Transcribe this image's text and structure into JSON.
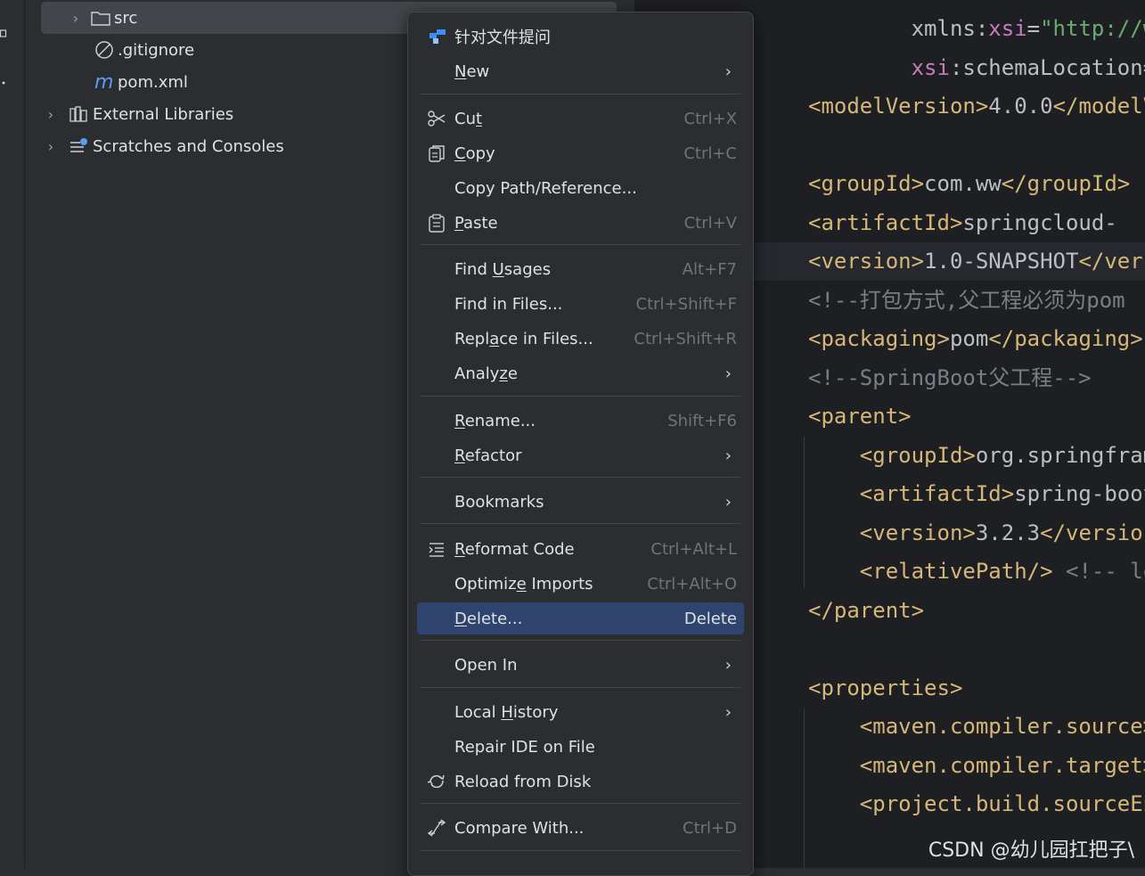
{
  "tree": {
    "items": [
      {
        "name": "src",
        "icon": "folder-icon",
        "expandable": true
      },
      {
        "name": ".gitignore",
        "icon": "ignore-file-icon",
        "expandable": false
      },
      {
        "name": "pom.xml",
        "icon": "maven-icon",
        "expandable": false
      },
      {
        "name": "External Libraries",
        "icon": "library-icon",
        "expandable": true
      },
      {
        "name": "Scratches and Consoles",
        "icon": "scratches-icon",
        "expandable": true
      }
    ]
  },
  "menu": {
    "items": [
      {
        "label": "针对文件提问",
        "shortcut": "",
        "submenu": false,
        "icon": "ai-ask-icon"
      },
      {
        "label": "New",
        "shortcut": "",
        "submenu": true,
        "icon": "",
        "u": 0
      },
      {
        "label": "Cut",
        "shortcut": "Ctrl+X",
        "submenu": false,
        "icon": "scissors-icon",
        "u": 2
      },
      {
        "label": "Copy",
        "shortcut": "Ctrl+C",
        "submenu": false,
        "icon": "copy-icon",
        "u": 0
      },
      {
        "label": "Copy Path/Reference...",
        "shortcut": "",
        "submenu": false,
        "icon": ""
      },
      {
        "label": "Paste",
        "shortcut": "Ctrl+V",
        "submenu": false,
        "icon": "clipboard-icon",
        "u": 0
      },
      {
        "label": "Find Usages",
        "shortcut": "Alt+F7",
        "submenu": false,
        "icon": "",
        "u": 5
      },
      {
        "label": "Find in Files...",
        "shortcut": "Ctrl+Shift+F",
        "submenu": false,
        "icon": ""
      },
      {
        "label": "Replace in Files...",
        "shortcut": "Ctrl+Shift+R",
        "submenu": false,
        "icon": "",
        "u": 4
      },
      {
        "label": "Analyze",
        "shortcut": "",
        "submenu": true,
        "icon": "",
        "u": 5
      },
      {
        "label": "Rename...",
        "shortcut": "Shift+F6",
        "submenu": false,
        "icon": "",
        "u": 0
      },
      {
        "label": "Refactor",
        "shortcut": "",
        "submenu": true,
        "icon": "",
        "u": 0
      },
      {
        "label": "Bookmarks",
        "shortcut": "",
        "submenu": true,
        "icon": ""
      },
      {
        "label": "Reformat Code",
        "shortcut": "Ctrl+Alt+L",
        "submenu": false,
        "icon": "reformat-icon",
        "u": 0
      },
      {
        "label": "Optimize Imports",
        "shortcut": "Ctrl+Alt+O",
        "submenu": false,
        "icon": "",
        "u": 7
      },
      {
        "label": "Delete...",
        "shortcut": "Delete",
        "submenu": false,
        "icon": "",
        "u": 0,
        "highlighted": true
      },
      {
        "label": "Open In",
        "shortcut": "",
        "submenu": true,
        "icon": ""
      },
      {
        "label": "Local History",
        "shortcut": "",
        "submenu": true,
        "icon": "",
        "u": 6
      },
      {
        "label": "Repair IDE on File",
        "shortcut": "",
        "submenu": false,
        "icon": ""
      },
      {
        "label": "Reload from Disk",
        "shortcut": "",
        "submenu": false,
        "icon": "reload-icon"
      },
      {
        "label": "Compare With...",
        "shortcut": "Ctrl+D",
        "submenu": false,
        "icon": "compare-icon"
      }
    ]
  },
  "editor": {
    "lines": [
      [
        {
          "t": "        xmlns:",
          "c": "plain"
        },
        {
          "t": "xsi",
          "c": "attr"
        },
        {
          "t": "=",
          "c": "plain"
        },
        {
          "t": "\"http://www",
          "c": "str"
        }
      ],
      [
        {
          "t": "        ",
          "c": "plain"
        },
        {
          "t": "xsi",
          "c": "attr"
        },
        {
          "t": ":schemaLocation=",
          "c": "plain"
        }
      ],
      [
        {
          "t": "<modelVersion>",
          "c": "tag"
        },
        {
          "t": "4.0.0",
          "c": "plain"
        },
        {
          "t": "</modelVersion>",
          "c": "tag"
        }
      ],
      [],
      [
        {
          "t": "<groupId>",
          "c": "tag"
        },
        {
          "t": "com.ww",
          "c": "plain"
        },
        {
          "t": "</groupId>",
          "c": "tag"
        }
      ],
      [
        {
          "t": "<artifactId>",
          "c": "tag"
        },
        {
          "t": "springcloud-",
          "c": "plain"
        }
      ],
      [
        {
          "t": "<version>",
          "c": "tag"
        },
        {
          "t": "1.0-SNAPSHOT",
          "c": "plain"
        },
        {
          "t": "</version>",
          "c": "tag"
        }
      ],
      [
        {
          "t": "<!--打包方式,父工程必须为pom",
          "c": "cmt"
        }
      ],
      [
        {
          "t": "<packaging>",
          "c": "tag"
        },
        {
          "t": "pom",
          "c": "plain"
        },
        {
          "t": "</packaging>",
          "c": "tag"
        }
      ],
      [
        {
          "t": "<!--SpringBoot父工程-->",
          "c": "cmt"
        }
      ],
      [
        {
          "t": "<parent>",
          "c": "tag"
        }
      ],
      [
        {
          "t": "    ",
          "c": "plain"
        },
        {
          "t": "<groupId>",
          "c": "tag"
        },
        {
          "t": "org.springframework",
          "c": "plain"
        }
      ],
      [
        {
          "t": "    ",
          "c": "plain"
        },
        {
          "t": "<artifactId>",
          "c": "tag"
        },
        {
          "t": "spring-boot",
          "c": "plain"
        }
      ],
      [
        {
          "t": "    ",
          "c": "plain"
        },
        {
          "t": "<version>",
          "c": "tag"
        },
        {
          "t": "3.2.3",
          "c": "plain"
        },
        {
          "t": "</version>",
          "c": "tag"
        }
      ],
      [
        {
          "t": "    ",
          "c": "plain"
        },
        {
          "t": "<relativePath/>",
          "c": "tag"
        },
        {
          "t": " <!-- lookup",
          "c": "cmt"
        }
      ],
      [
        {
          "t": "</parent>",
          "c": "tag"
        }
      ],
      [],
      [
        {
          "t": "<properties>",
          "c": "tag"
        }
      ],
      [
        {
          "t": "    ",
          "c": "plain"
        },
        {
          "t": "<maven.compiler.source>",
          "c": "tag"
        }
      ],
      [
        {
          "t": "    ",
          "c": "plain"
        },
        {
          "t": "<maven.compiler.target>",
          "c": "tag"
        }
      ],
      [
        {
          "t": "    ",
          "c": "plain"
        },
        {
          "t": "<project.build.sourceEncoding>",
          "c": "tag"
        }
      ]
    ],
    "watermark": "CSDN @幼儿园扛把子\\"
  }
}
